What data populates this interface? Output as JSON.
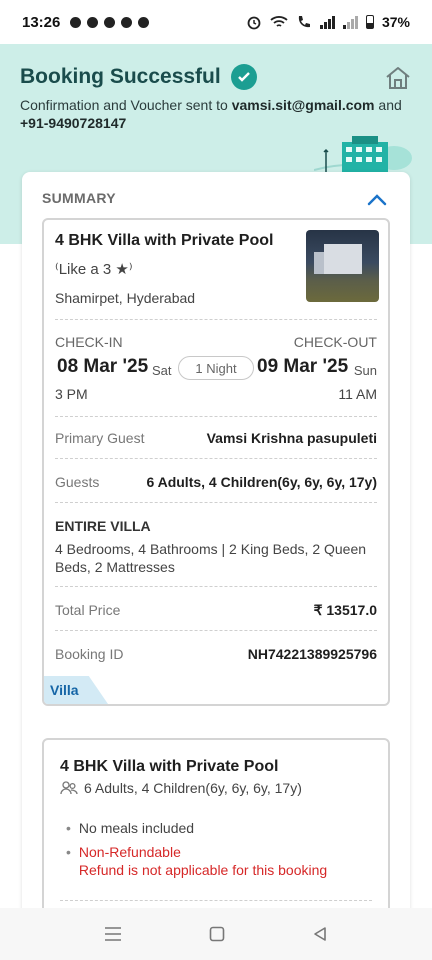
{
  "status_bar": {
    "time": "13:26",
    "battery": "37%"
  },
  "header": {
    "title": "Booking Successful",
    "confirmation_prefix": "Confirmation and Voucher sent to",
    "email": "vamsi.sit@gmail.com",
    "connector": "and",
    "phone": "+91-9490728147"
  },
  "summary": {
    "heading": "SUMMARY",
    "property_name": "4 BHK Villa with Private Pool",
    "rating_label": "Like a 3",
    "location": "Shamirpet, Hyderabad",
    "checkin_label": "CHECK-IN",
    "checkout_label": "CHECK-OUT",
    "checkin_date": "08 Mar '25",
    "checkin_day": "Sat",
    "nights": "1 Night",
    "checkout_date": "09 Mar '25",
    "checkout_day": "Sun",
    "checkin_time": "3 PM",
    "checkout_time": "11 AM",
    "primary_guest_label": "Primary Guest",
    "primary_guest_value": "Vamsi Krishna  pasupuleti",
    "guests_label": "Guests",
    "guests_value": "6 Adults, 4 Children(6y, 6y, 6y, 17y)",
    "villa_heading": "ENTIRE VILLA",
    "villa_description": "4 Bedrooms, 4 Bathrooms | 2 King Beds, 2 Queen Beds, 2 Mattresses",
    "total_price_label": "Total Price",
    "total_price_value": "₹ 13517.0",
    "booking_id_label": "Booking ID",
    "booking_id_value": "NH74221389925796",
    "tag": "Villa"
  },
  "room_card": {
    "name": "4 BHK Villa with Private Pool",
    "guests": "6 Adults, 4 Children(6y, 6y, 6y, 17y)",
    "meals": "No meals included",
    "refund_title": "Non-Refundable",
    "refund_note": "Refund is not applicable for this booking"
  },
  "colors": {
    "hero_bg": "#cdeee8",
    "accent_teal": "#1c9e92",
    "link_blue": "#1565a6",
    "error_red": "#d62828"
  }
}
